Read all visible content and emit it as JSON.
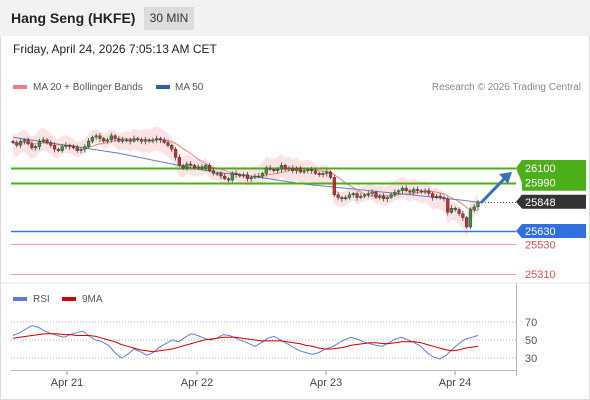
{
  "header": {
    "title": "Hang Seng (HKFE)",
    "timeframe": "30 MIN",
    "datetime": "Friday, April 24, 2026 7:05:13 AM CET"
  },
  "chart_data": [
    {
      "type": "candlestick",
      "legend": [
        {
          "name": "MA 20 + Bollinger Bands",
          "color": "#f08080"
        },
        {
          "name": "MA 50",
          "color": "#3060a0"
        }
      ],
      "copyright": "Research © 2026 Trading Central",
      "xlabels": [
        "Apr 21",
        "Apr 22",
        "Apr 23",
        "Apr 24"
      ],
      "ylim": [
        25280,
        26420
      ],
      "levels": [
        {
          "label": "26100",
          "value": 26100,
          "style": "resistance",
          "color": "#4caf1a"
        },
        {
          "label": "25990",
          "value": 25990,
          "style": "resistance",
          "color": "#4caf1a"
        },
        {
          "label": "25848",
          "value": 25848,
          "style": "last",
          "color": "#333333"
        },
        {
          "label": "25630",
          "value": 25630,
          "style": "pivot",
          "color": "#3a78e0"
        },
        {
          "label": "25530",
          "value": 25530,
          "style": "support",
          "color": "#e05050"
        },
        {
          "label": "25310",
          "value": 25310,
          "style": "support",
          "color": "#e05050"
        }
      ],
      "closes": [
        26290,
        26270,
        26300,
        26310,
        26280,
        26250,
        26260,
        26300,
        26310,
        26290,
        26270,
        26240,
        26230,
        26260,
        26270,
        26260,
        26250,
        26230,
        26240,
        26260,
        26300,
        26330,
        26340,
        26320,
        26300,
        26310,
        26340,
        26320,
        26300,
        26310,
        26310,
        26300,
        26320,
        26310,
        26300,
        26310,
        26300,
        26310,
        26320,
        26310,
        26290,
        26270,
        26240,
        26180,
        26120,
        26100,
        26130,
        26120,
        26100,
        26110,
        26100,
        26120,
        26080,
        26060,
        26060,
        26040,
        26020,
        26010,
        26060,
        26050,
        26040,
        26050,
        26020,
        26030,
        26040,
        26040,
        26060,
        26100,
        26090,
        26080,
        26090,
        26120,
        26090,
        26100,
        26080,
        26100,
        26070,
        26080,
        26090,
        26080,
        26060,
        26050,
        26060,
        26070,
        26030,
        25900,
        25880,
        25870,
        25880,
        25900,
        25910,
        25880,
        25890,
        25900,
        25910,
        25920,
        25880,
        25890,
        25870,
        25880,
        25900,
        25920,
        25930,
        25950,
        25930,
        25920,
        25940,
        25930,
        25920,
        25930,
        25910,
        25880,
        25890,
        25880,
        25870,
        25770,
        25800,
        25790,
        25760,
        25730,
        25660,
        25790,
        25810,
        25848
      ],
      "bollinger": {
        "upper_offset": 70,
        "lower_offset": 70
      },
      "ma50": [
        26330,
        26300,
        26270,
        26240,
        26210,
        26170,
        26130,
        26090,
        26060,
        26040,
        26010,
        25980,
        25960,
        25940,
        25920,
        25900,
        25880,
        25860,
        25840
      ],
      "ma50_x": [
        0,
        7,
        14,
        21,
        28,
        35,
        42,
        49,
        56,
        63,
        70,
        77,
        84,
        91,
        98,
        105,
        112,
        119,
        124
      ]
    },
    {
      "type": "line",
      "legend": [
        {
          "name": "RSI",
          "color": "#5b7fd8"
        },
        {
          "name": "9MA",
          "color": "#cc0000"
        }
      ],
      "ylim": [
        20,
        80
      ],
      "yticks": [
        "70",
        "50",
        "30"
      ],
      "series": [
        {
          "name": "RSI",
          "values": [
            55,
            58,
            62,
            66,
            64,
            60,
            57,
            55,
            53,
            56,
            58,
            60,
            54,
            50,
            48,
            44,
            36,
            30,
            34,
            40,
            37,
            33,
            36,
            42,
            46,
            50,
            48,
            53,
            57,
            55,
            52,
            50,
            52,
            56,
            55,
            52,
            49,
            46,
            43,
            47,
            52,
            54,
            50,
            46,
            42,
            38,
            36,
            34,
            36,
            40,
            42,
            46,
            50,
            53,
            51,
            48,
            46,
            44,
            43,
            47,
            51,
            53,
            50,
            47,
            43,
            36,
            31,
            29,
            33,
            40,
            46,
            51,
            53,
            55
          ]
        },
        {
          "name": "9MA",
          "values": [
            52,
            53,
            54,
            55,
            56,
            57,
            57,
            57,
            56,
            56,
            55,
            55,
            55,
            54,
            52,
            50,
            48,
            45,
            43,
            41,
            39,
            38,
            37,
            38,
            39,
            40,
            42,
            44,
            46,
            48,
            50,
            51,
            52,
            53,
            53,
            53,
            52,
            51,
            50,
            49,
            49,
            49,
            49,
            48,
            47,
            46,
            44,
            43,
            41,
            40,
            40,
            41,
            42,
            44,
            45,
            46,
            47,
            47,
            46,
            46,
            47,
            48,
            48,
            48,
            47,
            45,
            43,
            41,
            39,
            38,
            39,
            41,
            42,
            43
          ]
        }
      ]
    }
  ]
}
